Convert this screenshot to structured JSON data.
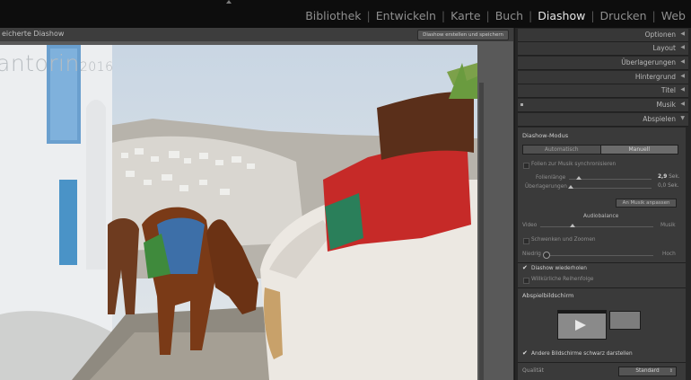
{
  "modules": [
    "Bibliothek",
    "Entwickeln",
    "Karte",
    "Buch",
    "Diashow",
    "Drucken",
    "Web"
  ],
  "active_module": "Diashow",
  "left": {
    "subbar_title": "eicherte Diashow",
    "save_button": "Diashow erstellen und speichern"
  },
  "slide": {
    "title": "antorin",
    "year": "2016"
  },
  "panel": {
    "collapsed": [
      "Optionen",
      "Layout",
      "Überlagerungen",
      "Hintergrund",
      "Titel",
      "Musik"
    ],
    "playback_header": "Abspielen",
    "mode_title": "Diashow-Modus",
    "mode_auto": "Automatisch",
    "mode_manual": "Manuell",
    "sync_music": "Folien zur Musik synchronisieren",
    "slide_length_label": "Folienlänge",
    "slide_length_value": "2,9",
    "slide_length_unit": "Sek.",
    "overlap_label": "Überlagerungen",
    "overlap_value": "0,0",
    "overlap_unit": "Sek.",
    "fit_music_button": "An Musik anpassen",
    "audio_balance": "Audiobalance",
    "audio_left": "Video",
    "audio_right": "Musik",
    "pan_zoom": "Schwenken und Zoomen",
    "pan_low": "Niedrig",
    "pan_high": "Hoch",
    "repeat": "Diashow wiederholen",
    "random": "Willkürliche Reihenfolge",
    "screen_title": "Abspielbildschirm",
    "blackout": "Andere Bildschirme schwarz darstellen",
    "quality_label": "Qualität",
    "quality_value": "Standard"
  }
}
